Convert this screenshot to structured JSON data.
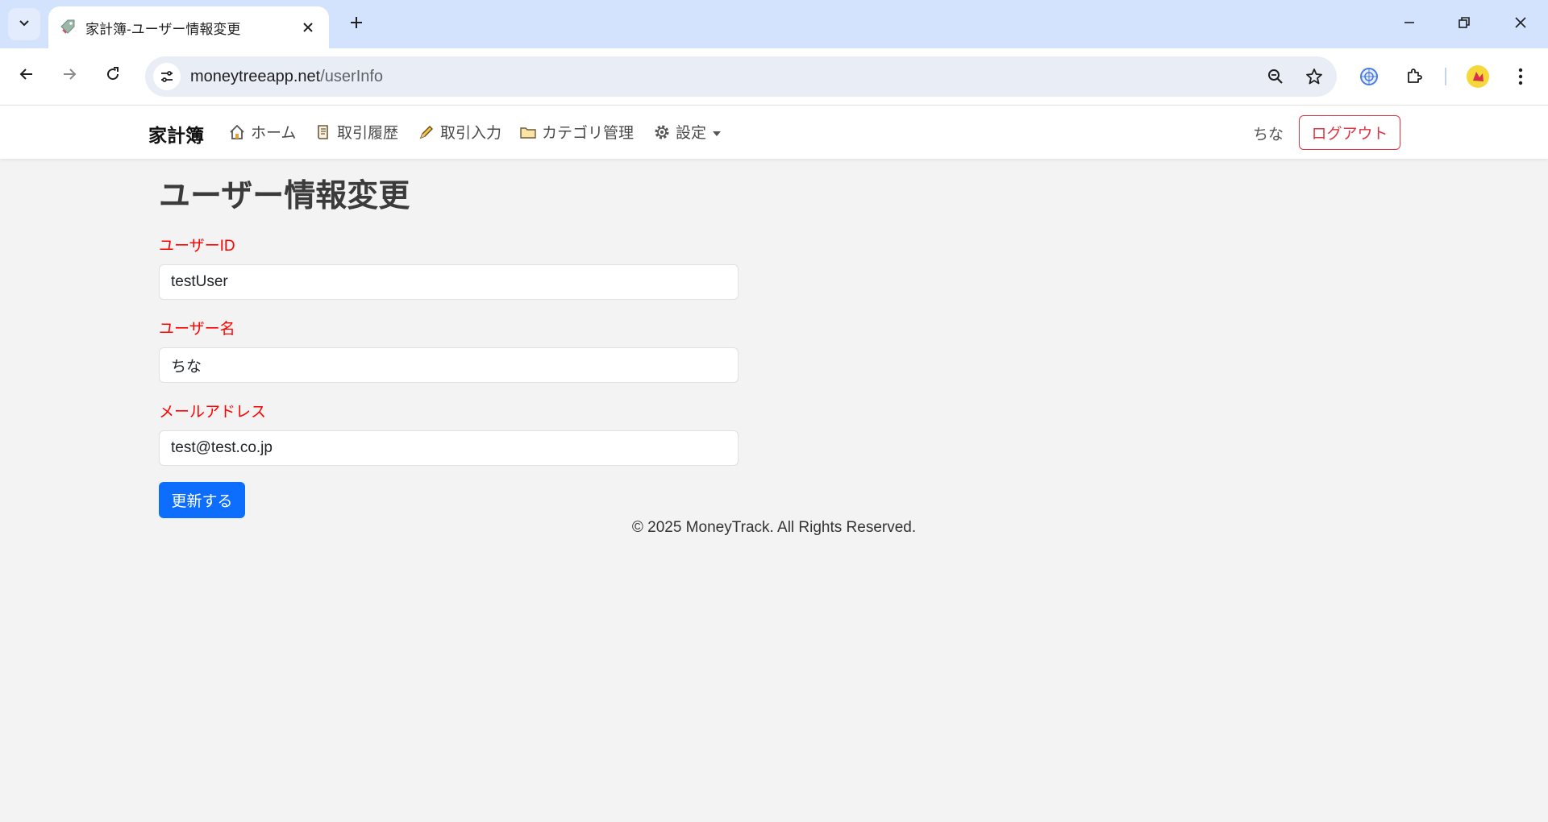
{
  "browser": {
    "tab_title": "家計簿-ユーザー情報変更",
    "url_domain": "moneytreeapp.net",
    "url_path": "/userInfo"
  },
  "nav": {
    "brand": "家計簿",
    "links": [
      {
        "label": "ホーム",
        "icon": "home-icon"
      },
      {
        "label": "取引履歴",
        "icon": "scroll-icon"
      },
      {
        "label": "取引入力",
        "icon": "pencil-icon"
      },
      {
        "label": "カテゴリ管理",
        "icon": "folder-icon"
      },
      {
        "label": "設定",
        "icon": "gear-icon"
      }
    ],
    "user_name": "ちな",
    "logout_label": "ログアウト"
  },
  "page": {
    "title": "ユーザー情報変更",
    "fields": [
      {
        "label": "ユーザーID",
        "value": "testUser"
      },
      {
        "label": "ユーザー名",
        "value": "ちな"
      },
      {
        "label": "メールアドレス",
        "value": "test@test.co.jp"
      }
    ],
    "submit_label": "更新する"
  },
  "footer": {
    "text": "© 2025 MoneyTrack. All Rights Reserved."
  },
  "colors": {
    "primary": "#0d6efd",
    "danger": "#dc3545",
    "label_red": "#ff0000",
    "page_bg": "#f3f3f3"
  }
}
